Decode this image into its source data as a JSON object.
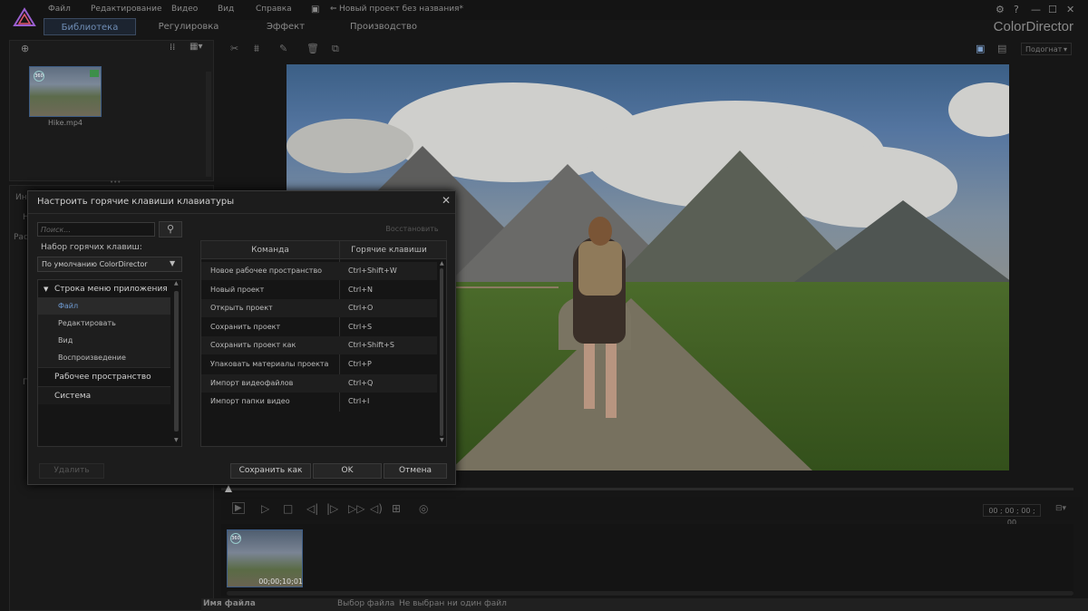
{
  "menu": {
    "items": [
      "Файл",
      "Редактирование",
      "Видео",
      "Вид",
      "Справка"
    ],
    "project_title": "Новый проект без названия*",
    "app_name": "ColorDirector"
  },
  "tabs": [
    "Библиотека",
    "Регулировка",
    "Эффект",
    "Производство"
  ],
  "library": {
    "media_label": "Hike.mp4"
  },
  "left_panel": {
    "fragment1": "Ин",
    "fragment2": "Н",
    "fragment3": "Рас",
    "fragment4": "П"
  },
  "preview": {
    "fit_select": "Подогнат"
  },
  "transport": {
    "timecode": "00 ; 00 ; 00 ; 00"
  },
  "timeline": {
    "clip_timecode": "00;00;10;01"
  },
  "bottom_strip": {
    "col1": "Имя файла",
    "col2": "Выбор файла",
    "col3": "Не выбран ни один файл"
  },
  "dialog": {
    "title": "Настроить горячие клавиши клавиатуры",
    "search_placeholder": "Поиск...",
    "hotkey_set_label": "Набор горячих клавиш:",
    "hotkey_set_value": "По умолчанию ColorDirector",
    "restore_label": "Восстановить",
    "tree": {
      "group_app_menu": "Строка меню приложения",
      "items": [
        "Файл",
        "Редактировать",
        "Вид",
        "Воспроизведение"
      ],
      "workspace": "Рабочее пространство",
      "system": "Система"
    },
    "table": {
      "col_command": "Команда",
      "col_hotkey": "Горячие клавиши",
      "rows": [
        {
          "command": "Новое рабочее пространство",
          "hotkey": "Ctrl+Shift+W"
        },
        {
          "command": "Новый проект",
          "hotkey": "Ctrl+N"
        },
        {
          "command": "Открыть проект",
          "hotkey": "Ctrl+O"
        },
        {
          "command": "Сохранить проект",
          "hotkey": "Ctrl+S"
        },
        {
          "command": "Сохранить проект как",
          "hotkey": "Ctrl+Shift+S"
        },
        {
          "command": "Упаковать материалы проекта",
          "hotkey": "Ctrl+P"
        },
        {
          "command": "Импорт видеофайлов",
          "hotkey": "Ctrl+Q"
        },
        {
          "command": "Импорт папки видео",
          "hotkey": "Ctrl+I"
        }
      ]
    },
    "buttons": {
      "delete": "Удалить",
      "save_as": "Сохранить как",
      "ok": "OK",
      "cancel": "Отмена"
    }
  },
  "colors": {
    "accent": "#6f8db5",
    "background": "#161616",
    "dialog_bg": "#1c1c1c"
  }
}
